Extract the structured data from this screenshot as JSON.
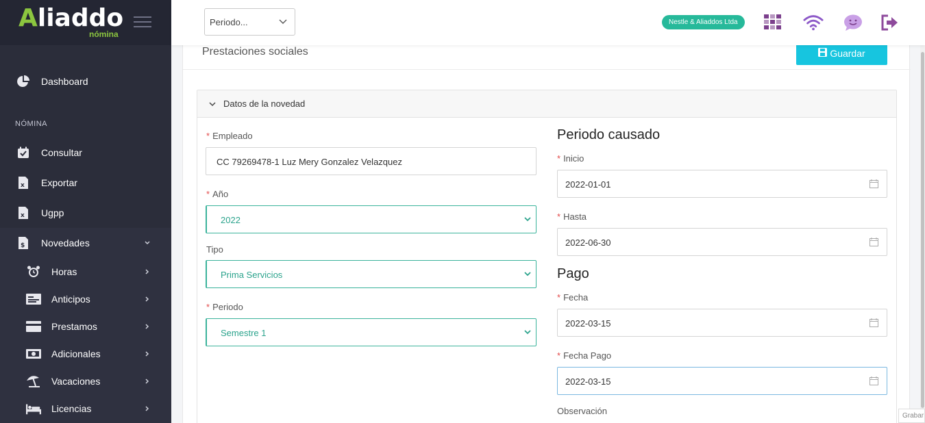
{
  "brand": {
    "name_mark": "A",
    "name_rest": "liaddo",
    "sub": "nómina",
    "accent": "#8cc63f"
  },
  "sidebar": {
    "dashboard": "Dashboard",
    "section": "NÓMINA",
    "items": [
      {
        "label": "Consultar",
        "icon": "calendar-check-icon"
      },
      {
        "label": "Exportar",
        "icon": "excel-file-icon"
      },
      {
        "label": "Ugpp",
        "icon": "excel-file-icon"
      },
      {
        "label": "Novedades",
        "icon": "money-file-icon"
      }
    ],
    "subitems": [
      {
        "label": "Horas",
        "icon": "alarm-clock-icon"
      },
      {
        "label": "Anticipos",
        "icon": "id-card-icon"
      },
      {
        "label": "Prestamos",
        "icon": "credit-card-icon"
      },
      {
        "label": "Adicionales",
        "icon": "banknote-icon"
      },
      {
        "label": "Vacaciones",
        "icon": "beach-umbrella-icon"
      },
      {
        "label": "Licencias",
        "icon": "bed-icon"
      }
    ]
  },
  "header": {
    "period_placeholder": "Periodo...",
    "company": "Nestle & Aliaddos Ltda",
    "badge_color": "#26b99a"
  },
  "page": {
    "title": "Prestaciones sociales",
    "save_label": "Guardar",
    "save_color": "#17c5df"
  },
  "panel": {
    "title": "Datos de la novedad",
    "empleado_label": "Empleado",
    "empleado_value": "CC 79269478-1 Luz Mery Gonzalez Velazquez",
    "anio_label": "Año",
    "anio_value": "2022",
    "tipo_label": "Tipo",
    "tipo_value": "Prima Servicios",
    "periodo_label": "Periodo",
    "periodo_value": "Semestre 1",
    "periodo_causado_heading": "Periodo causado",
    "inicio_label": "Inicio",
    "inicio_value": "2022-01-01",
    "hasta_label": "Hasta",
    "hasta_value": "2022-06-30",
    "pago_heading": "Pago",
    "fecha_label": "Fecha",
    "fecha_value": "2022-03-15",
    "fecha_pago_label": "Fecha Pago",
    "fecha_pago_value": "2022-03-15",
    "observacion_label": "Observación"
  },
  "corner_text": "Grabar"
}
